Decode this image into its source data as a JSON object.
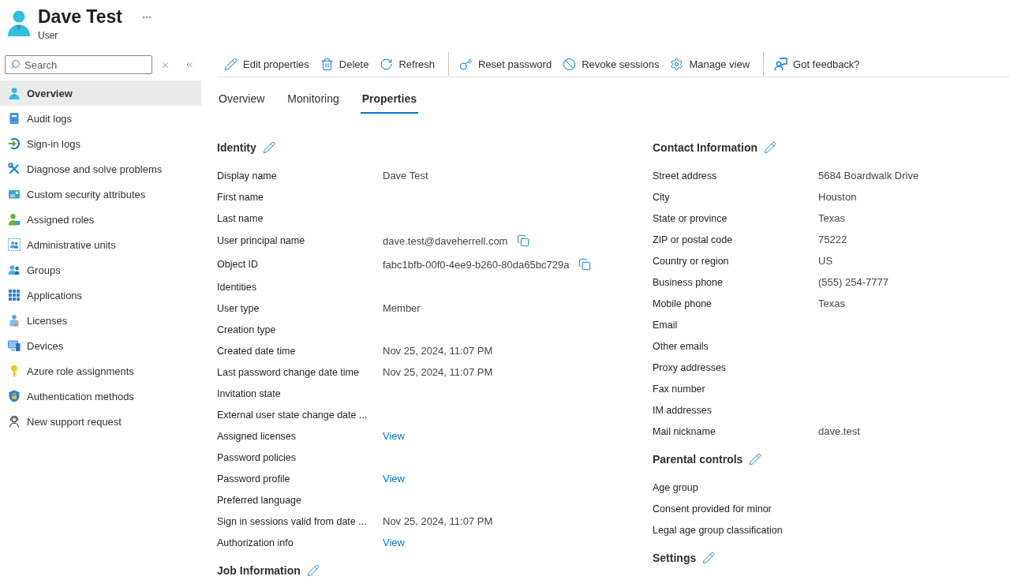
{
  "header": {
    "title": "Dave Test",
    "subtitle": "User"
  },
  "search": {
    "placeholder": "Search"
  },
  "sidebar": {
    "items": [
      {
        "label": "Overview",
        "selected": true
      },
      {
        "label": "Audit logs",
        "selected": false
      },
      {
        "label": "Sign-in logs",
        "selected": false
      },
      {
        "label": "Diagnose and solve problems",
        "selected": false
      },
      {
        "label": "Custom security attributes",
        "selected": false
      },
      {
        "label": "Assigned roles",
        "selected": false
      },
      {
        "label": "Administrative units",
        "selected": false
      },
      {
        "label": "Groups",
        "selected": false
      },
      {
        "label": "Applications",
        "selected": false
      },
      {
        "label": "Licenses",
        "selected": false
      },
      {
        "label": "Devices",
        "selected": false
      },
      {
        "label": "Azure role assignments",
        "selected": false
      },
      {
        "label": "Authentication methods",
        "selected": false
      },
      {
        "label": "New support request",
        "selected": false
      }
    ]
  },
  "toolbar": {
    "groups": [
      {
        "buttons": [
          "Edit properties",
          "Delete",
          "Refresh"
        ]
      },
      {
        "buttons": [
          "Reset password",
          "Revoke sessions",
          "Manage view"
        ]
      },
      {
        "buttons": [
          "Got feedback?"
        ]
      }
    ]
  },
  "tabs": [
    {
      "label": "Overview",
      "selected": false
    },
    {
      "label": "Monitoring",
      "selected": false
    },
    {
      "label": "Properties",
      "selected": true
    }
  ],
  "columns": [
    {
      "sections": [
        {
          "title": "Identity",
          "rows": [
            {
              "label": "Display name",
              "kind": "text",
              "value": "Dave Test"
            },
            {
              "label": "First name",
              "kind": "text"
            },
            {
              "label": "Last name",
              "kind": "text"
            },
            {
              "label": "User principal name",
              "kind": "copy",
              "value": "dave.test@daveherrell.com"
            },
            {
              "label": "Object ID",
              "kind": "copy",
              "value": "fabc1bfb-00f0-4ee9-b260-80da65bc729a"
            },
            {
              "label": "Identities",
              "kind": "text"
            },
            {
              "label": "User type",
              "kind": "text",
              "value": "Member"
            },
            {
              "label": "Creation type",
              "kind": "text"
            },
            {
              "label": "Created date time",
              "kind": "text",
              "value": "Nov 25, 2024, 11:07 PM"
            },
            {
              "label": "Last password change date time",
              "kind": "text",
              "value": "Nov 25, 2024, 11:07 PM"
            },
            {
              "label": "Invitation state",
              "kind": "text"
            },
            {
              "label": "External user state change date ...",
              "kind": "text"
            },
            {
              "label": "Assigned licenses",
              "kind": "link",
              "value": "View"
            },
            {
              "label": "Password policies",
              "kind": "text"
            },
            {
              "label": "Password profile",
              "kind": "link",
              "value": "View"
            },
            {
              "label": "Preferred language",
              "kind": "text"
            },
            {
              "label": "Sign in sessions valid from date ...",
              "kind": "text",
              "value": "Nov 25, 2024, 11:07 PM"
            },
            {
              "label": "Authorization info",
              "kind": "link",
              "value": "View"
            }
          ]
        },
        {
          "title": "Job Information"
        }
      ]
    },
    {
      "sections": [
        {
          "title": "Contact Information",
          "rows": [
            {
              "label": "Street address",
              "kind": "text",
              "value": "5684 Boardwalk Drive"
            },
            {
              "label": "City",
              "kind": "text",
              "value": "Houston"
            },
            {
              "label": "State or province",
              "kind": "text",
              "value": "Texas"
            },
            {
              "label": "ZIP or postal code",
              "kind": "text",
              "value": "75222"
            },
            {
              "label": "Country or region",
              "kind": "text",
              "value": "US"
            },
            {
              "label": "Business phone",
              "kind": "text",
              "value": "(555) 254-7777"
            },
            {
              "label": "Mobile phone",
              "kind": "text",
              "value": "Texas"
            },
            {
              "label": "Email",
              "kind": "text"
            },
            {
              "label": "Other emails",
              "kind": "text"
            },
            {
              "label": "Proxy addresses",
              "kind": "text"
            },
            {
              "label": "Fax number",
              "kind": "text"
            },
            {
              "label": "IM addresses",
              "kind": "text"
            },
            {
              "label": "Mail nickname",
              "kind": "text",
              "value": "dave.test"
            }
          ]
        },
        {
          "title": "Parental controls",
          "rows": [
            {
              "label": "Age group",
              "kind": "text"
            },
            {
              "label": "Consent provided for minor",
              "kind": "text"
            },
            {
              "label": "Legal age group classification",
              "kind": "text"
            }
          ]
        },
        {
          "title": "Settings"
        }
      ]
    }
  ]
}
